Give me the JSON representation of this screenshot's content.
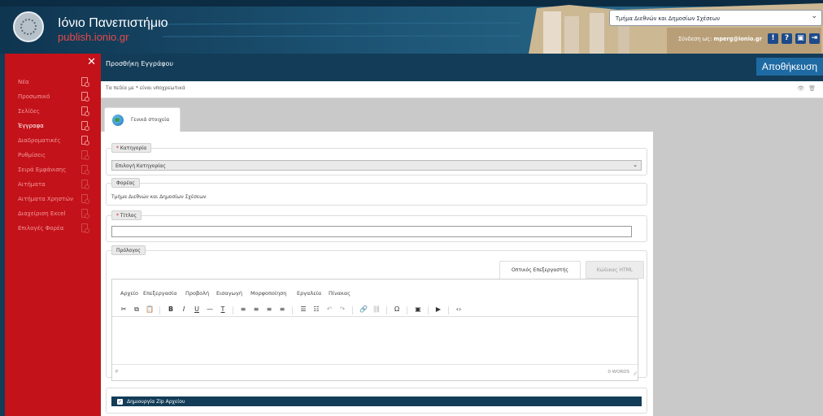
{
  "header": {
    "title": "Ιόνιο Πανεπιστήμιο",
    "url": "publish.ionio.gr",
    "department": "Τμήμα Διεθνών και Δημοσίων Σχέσεων",
    "login_prefix": "Σύνδεση ως:",
    "login_user": "mperg@ionio.gr",
    "icons": [
      "alert-icon",
      "help-icon",
      "lock-icon",
      "exit-icon"
    ]
  },
  "sidebar": {
    "close_symbol": "✕",
    "items": [
      {
        "label": "Νέα",
        "active": false
      },
      {
        "label": "Προσωπικό",
        "active": false
      },
      {
        "label": "Σελίδες",
        "active": false
      },
      {
        "label": "Έγγραφα",
        "active": true
      },
      {
        "label": "Διαδροματικές",
        "active": false
      },
      {
        "label": "Ρυθμίσεις",
        "active": false
      },
      {
        "label": "Σειρά Εμφάνισης",
        "active": false
      },
      {
        "label": "Αιτήματα",
        "active": false
      },
      {
        "label": "Αιτήματα Χρηστών",
        "active": false
      },
      {
        "label": "Διαχείριση Excel",
        "active": false
      },
      {
        "label": "Επιλογές Φορέα",
        "active": false
      }
    ]
  },
  "topbar": {
    "page_title": "Προσθήκη Εγγράφου",
    "save_label": "Αποθήκευση"
  },
  "required_note": "Τα πεδία με * είναι υποχρεωτικά",
  "tab": {
    "label": "Γενικά στοιχεία"
  },
  "form": {
    "category": {
      "star": "* ",
      "label": "Κατηγορία",
      "selected": "Επιλογή Κατηγορίας"
    },
    "organization": {
      "label": "Φορέας",
      "value": "Τμήμα Διεθνών και Δημοσίων Σχέσεων"
    },
    "title": {
      "star": "* ",
      "label": "Τίτλος",
      "value": ""
    },
    "prologue": {
      "label": "Πρόλογος",
      "tab_visual": "Οπτικός Επεξεργαστής",
      "tab_html": "Κώδικας HTML",
      "menu": [
        "Αρχείο",
        "Επεξεργασία",
        "Προβολή",
        "Εισαγωγή",
        "Μορφοποίηση",
        "Εργαλεία",
        "Πίνακας"
      ],
      "toolbar": {
        "cut": "✂",
        "copy": "⧉",
        "paste": "📋",
        "bold": "B",
        "italic": "I",
        "underline": "U",
        "hr": "—",
        "clear": "T",
        "align_left": "≡",
        "align_center": "≡",
        "align_right": "≡",
        "justify": "≡",
        "bullets": "☰",
        "numbers": "☷",
        "undo": "↶",
        "redo": "↷",
        "link": "🔗",
        "unlink": "⛓",
        "omega": "Ω",
        "image": "▣",
        "media": "▶",
        "code": "‹›"
      },
      "path": "P",
      "words": "0 WORDS"
    },
    "zip": {
      "check": "✓",
      "label": "Δημιουργία Zip Αρχείου"
    }
  }
}
